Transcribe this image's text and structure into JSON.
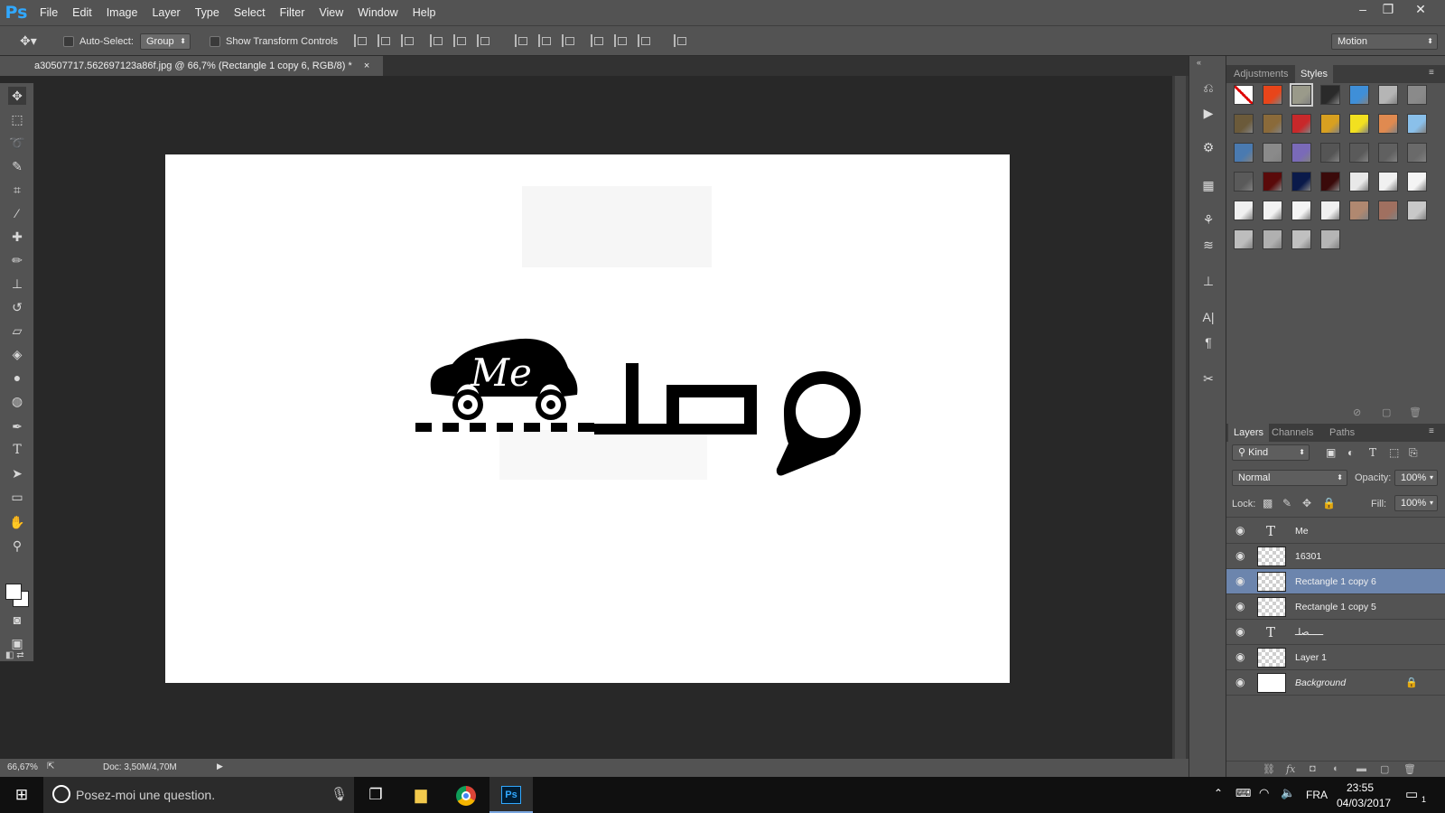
{
  "app": {
    "logo": "Ps"
  },
  "menu": [
    "File",
    "Edit",
    "Image",
    "Layer",
    "Type",
    "Select",
    "Filter",
    "View",
    "Window",
    "Help"
  ],
  "window_controls": {
    "minimize": "–",
    "restore": "❐",
    "close": "✕"
  },
  "options": {
    "auto_select_label": "Auto-Select:",
    "auto_select_value": "Group",
    "show_transform_label": "Show Transform Controls",
    "workspace": "Motion"
  },
  "document": {
    "tab_title": "a30507717.562697123a86f.jpg @ 66,7% (Rectangle 1 copy 6, RGB/8) *",
    "tab_close": "×",
    "zoom": "66,67%",
    "doc_info": "Doc: 3,50M/4,70M",
    "logo_script_text": "Me"
  },
  "styles_panel": {
    "tabs": [
      "Adjustments",
      "Styles"
    ],
    "active_tab": "Styles",
    "swatch_colors": [
      "#ffffff",
      "#e8451a",
      "#9a9a8a",
      "#2a2a2a",
      "#3f8fd8",
      "#b5b5b5",
      "#8a8a8a",
      "#6b5a3a",
      "#8a6a3a",
      "#c8282a",
      "#d8a020",
      "#f2e020",
      "#e08a50",
      "#8ac0ea",
      "#4a7ab0",
      "#8a8a8a",
      "#7a6ab8",
      "#555555",
      "#5a5a5a",
      "#606060",
      "#6a6a6a",
      "#5a5a5a",
      "#5a0a0a",
      "#0a1a4a",
      "#3a0a0a",
      "#e8e8e8",
      "#f0f0f0",
      "#f4f4f4",
      "#f0f0f0",
      "#f2f2f2",
      "#f4f4f4",
      "#f0f0f0",
      "#b08870",
      "#a07060",
      "#c8c8c8",
      "#bdbdbd",
      "#b0b0b0",
      "#c0c0c0",
      "#b5b5b5"
    ]
  },
  "layers_panel": {
    "tabs": [
      "Layers",
      "Channels",
      "Paths"
    ],
    "active_tab": "Layers",
    "filter_kind": "Kind",
    "blend_mode": "Normal",
    "opacity_label": "Opacity:",
    "opacity": "100%",
    "lock_label": "Lock:",
    "fill_label": "Fill:",
    "fill": "100%",
    "layers": [
      {
        "name": "Me",
        "kind": "text"
      },
      {
        "name": "16301",
        "kind": "image"
      },
      {
        "name": "Rectangle 1 copy 6",
        "kind": "shape",
        "selected": true
      },
      {
        "name": "Rectangle 1 copy 5",
        "kind": "shape"
      },
      {
        "name": "ـــــصلـ",
        "kind": "text"
      },
      {
        "name": "Layer 1",
        "kind": "image"
      },
      {
        "name": "Background",
        "kind": "background",
        "locked": true
      }
    ]
  },
  "taskbar": {
    "search_placeholder": "Posez-moi une question.",
    "language": "FRA",
    "time": "23:55",
    "date": "04/03/2017",
    "notification_count": "1"
  }
}
